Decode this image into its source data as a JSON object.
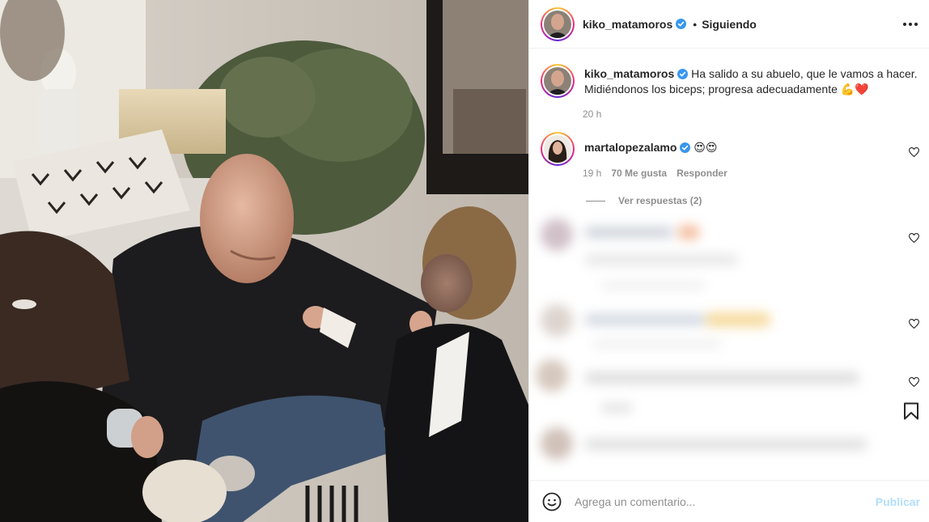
{
  "post": {
    "author": "kiko_matamoros",
    "follow_separator": "•",
    "follow_status": "Siguiendo"
  },
  "caption": {
    "author": "kiko_matamoros",
    "line1": "Ha salido a su abuelo, que le vamos a hacer.",
    "line2": "Midiéndonos los biceps; progresa adecuadamente",
    "emojis": "💪❤️",
    "time": "20 h"
  },
  "comments": [
    {
      "author": "martalopezalamo",
      "text": "😍😍",
      "time": "19 h",
      "likes": "70 Me gusta",
      "reply_label": "Responder",
      "view_replies": "Ver respuestas (2)"
    }
  ],
  "add_comment": {
    "placeholder": "Agrega un comentario...",
    "publish_label": "Publicar"
  },
  "colors": {
    "verified": "#3897f0",
    "publish_disabled": "#b2dffc",
    "muted_text": "#8e8e8e",
    "like_red": "#ed4956"
  },
  "icons": [
    "verified-badge-icon",
    "more-options-icon",
    "heart-icon",
    "bookmark-icon",
    "emoji-icon"
  ]
}
